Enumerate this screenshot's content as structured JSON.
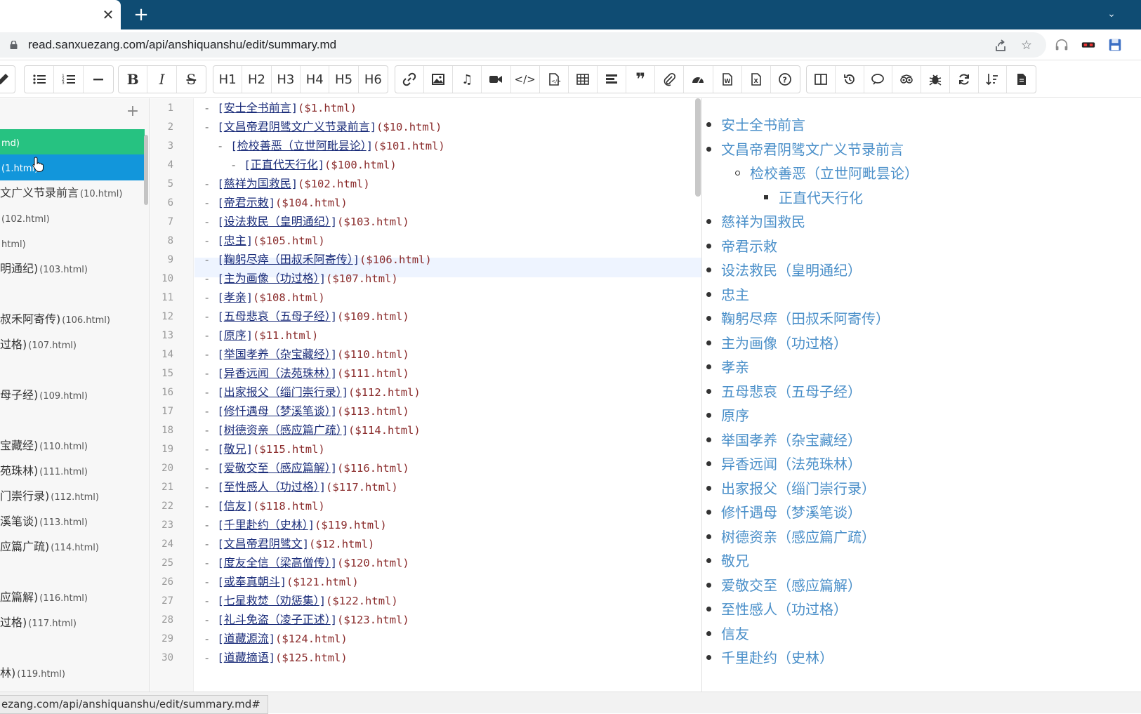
{
  "browser": {
    "url": "read.sanxuezang.com/api/anshiquanshu/edit/summary.md",
    "status_url": "ezang.com/api/anshiquanshu/edit/summary.md#"
  },
  "toolbar": {
    "headings": [
      "H1",
      "H2",
      "H3",
      "H4",
      "H5",
      "H6"
    ],
    "bold": "B",
    "italic": "I",
    "strike": "S"
  },
  "sidebar": {
    "items": [
      {
        "label": "",
        "file": "md)",
        "state": "green"
      },
      {
        "label": "",
        "file": "(1.html)",
        "state": "blue"
      },
      {
        "label": "文广义节录前言",
        "file": "(10.html)"
      },
      {
        "label": "",
        "file": "(102.html)"
      },
      {
        "label": "",
        "file": "html)"
      },
      {
        "label": "明通纪)",
        "file": "(103.html)"
      },
      {
        "label": "",
        "file": ""
      },
      {
        "label": "叔禾阿寄传)",
        "file": "(106.html)"
      },
      {
        "label": "过格)",
        "file": "(107.html)"
      },
      {
        "label": "",
        "file": ""
      },
      {
        "label": "母子经)",
        "file": "(109.html)"
      },
      {
        "label": "",
        "file": ""
      },
      {
        "label": "宝藏经)",
        "file": "(110.html)"
      },
      {
        "label": "苑珠林)",
        "file": "(111.html)"
      },
      {
        "label": "门崇行录)",
        "file": "(112.html)"
      },
      {
        "label": "溪笔谈)",
        "file": "(113.html)"
      },
      {
        "label": "应篇广疏)",
        "file": "(114.html)"
      },
      {
        "label": "",
        "file": ""
      },
      {
        "label": "应篇解)",
        "file": "(116.html)"
      },
      {
        "label": "过格)",
        "file": "(117.html)"
      },
      {
        "label": "",
        "file": ""
      },
      {
        "label": "林)",
        "file": "(119.html)"
      }
    ]
  },
  "editor": {
    "lines": [
      {
        "n": "1",
        "indent": 0,
        "text": "安士全书前言",
        "href": "($1.html)"
      },
      {
        "n": "2",
        "indent": 0,
        "text": "文昌帝君阴骘文广义节录前言",
        "href": "($10.html)"
      },
      {
        "n": "3",
        "indent": 1,
        "text": "检校善恶（立世阿毗昙论）",
        "href": "($101.html)"
      },
      {
        "n": "4",
        "indent": 2,
        "text": "正直代天行化",
        "href": "($100.html)"
      },
      {
        "n": "5",
        "indent": 0,
        "text": "慈祥为国救民",
        "href": "($102.html)"
      },
      {
        "n": "6",
        "indent": 0,
        "text": "帝君示敕",
        "href": "($104.html)"
      },
      {
        "n": "7",
        "indent": 0,
        "text": "设法救民（皇明通纪）",
        "href": "($103.html)"
      },
      {
        "n": "8",
        "indent": 0,
        "text": "忠主",
        "href": "($105.html)"
      },
      {
        "n": "9",
        "indent": 0,
        "text": "鞠躬尽瘁（田叔禾阿寄传）",
        "href": "($106.html)"
      },
      {
        "n": "10",
        "indent": 0,
        "text": "主为画像（功过格）",
        "href": "($107.html)"
      },
      {
        "n": "11",
        "indent": 0,
        "text": "孝亲",
        "href": "($108.html)"
      },
      {
        "n": "12",
        "indent": 0,
        "text": "五母悲哀（五母子经）",
        "href": "($109.html)"
      },
      {
        "n": "13",
        "indent": 0,
        "text": "原序",
        "href": "($11.html)"
      },
      {
        "n": "14",
        "indent": 0,
        "text": "举国孝养（杂宝藏经）",
        "href": "($110.html)"
      },
      {
        "n": "15",
        "indent": 0,
        "text": "异香远闻（法苑珠林）",
        "href": "($111.html)"
      },
      {
        "n": "16",
        "indent": 0,
        "text": "出家报父（缁门崇行录）",
        "href": "($112.html)"
      },
      {
        "n": "17",
        "indent": 0,
        "text": "修忏遇母（梦溪笔谈）",
        "href": "($113.html)"
      },
      {
        "n": "18",
        "indent": 0,
        "text": "树德资亲（感应篇广疏）",
        "href": "($114.html)"
      },
      {
        "n": "19",
        "indent": 0,
        "text": "敬兄",
        "href": "($115.html)"
      },
      {
        "n": "20",
        "indent": 0,
        "text": "爱敬交至（感应篇解）",
        "href": "($116.html)"
      },
      {
        "n": "21",
        "indent": 0,
        "text": "至性感人（功过格）",
        "href": "($117.html)"
      },
      {
        "n": "22",
        "indent": 0,
        "text": "信友",
        "href": "($118.html)"
      },
      {
        "n": "23",
        "indent": 0,
        "text": "千里赴约（史林）",
        "href": "($119.html)"
      },
      {
        "n": "24",
        "indent": 0,
        "text": "文昌帝君阴骘文",
        "href": "($12.html)"
      },
      {
        "n": "25",
        "indent": 0,
        "text": "度友全信（梁高僧传）",
        "href": "($120.html)"
      },
      {
        "n": "26",
        "indent": 0,
        "text": "或奉真朝斗",
        "href": "($121.html)"
      },
      {
        "n": "27",
        "indent": 0,
        "text": "七星救焚（劝惩集）",
        "href": "($122.html)"
      },
      {
        "n": "28",
        "indent": 0,
        "text": "礼斗免盗（凌子正述）",
        "href": "($123.html)"
      },
      {
        "n": "29",
        "indent": 0,
        "text": "道藏源流",
        "href": "($124.html)"
      },
      {
        "n": "30",
        "indent": 0,
        "text": "道藏摘语",
        "href": "($125.html)"
      }
    ]
  },
  "preview": {
    "items": [
      {
        "text": "安士全书前言",
        "level": 0
      },
      {
        "text": "文昌帝君阴骘文广义节录前言",
        "level": 0
      },
      {
        "text": "检校善恶（立世阿毗昙论）",
        "level": 1
      },
      {
        "text": "正直代天行化",
        "level": 2
      },
      {
        "text": "慈祥为国救民",
        "level": 0
      },
      {
        "text": "帝君示敕",
        "level": 0
      },
      {
        "text": "设法救民（皇明通纪）",
        "level": 0
      },
      {
        "text": "忠主",
        "level": 0
      },
      {
        "text": "鞠躬尽瘁（田叔禾阿寄传）",
        "level": 0
      },
      {
        "text": "主为画像（功过格）",
        "level": 0
      },
      {
        "text": "孝亲",
        "level": 0
      },
      {
        "text": "五母悲哀（五母子经）",
        "level": 0
      },
      {
        "text": "原序",
        "level": 0
      },
      {
        "text": "举国孝养（杂宝藏经）",
        "level": 0
      },
      {
        "text": "异香远闻（法苑珠林）",
        "level": 0
      },
      {
        "text": "出家报父（缁门崇行录）",
        "level": 0
      },
      {
        "text": "修忏遇母（梦溪笔谈）",
        "level": 0
      },
      {
        "text": "树德资亲（感应篇广疏）",
        "level": 0
      },
      {
        "text": "敬兄",
        "level": 0
      },
      {
        "text": "爱敬交至（感应篇解）",
        "level": 0
      },
      {
        "text": "至性感人（功过格）",
        "level": 0
      },
      {
        "text": "信友",
        "level": 0
      },
      {
        "text": "千里赴约（史林）",
        "level": 0
      }
    ]
  },
  "colors": {
    "tabstrip": "#0f4c73",
    "active_green": "#26c281",
    "active_blue": "#1296db",
    "preview_link": "#4a8fc9"
  }
}
